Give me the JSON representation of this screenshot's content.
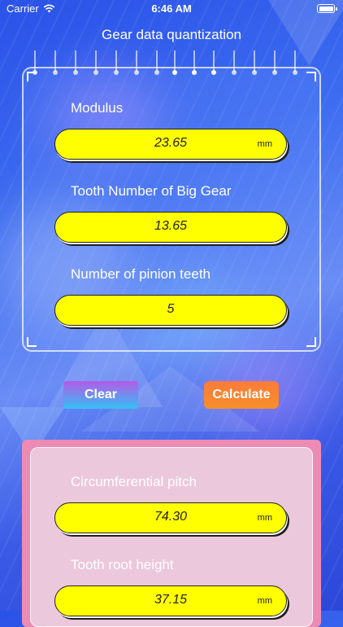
{
  "status": {
    "carrier": "Carrier",
    "time": "6:46 AM"
  },
  "title": "Gear data quantization",
  "inputs": [
    {
      "label": "Modulus",
      "value": "23.65",
      "unit": "mm"
    },
    {
      "label": "Tooth Number of Big Gear",
      "value": "13.65",
      "unit": ""
    },
    {
      "label": "Number of pinion teeth",
      "value": "5",
      "unit": ""
    }
  ],
  "buttons": {
    "clear": "Clear",
    "calculate": "Calculate"
  },
  "results": [
    {
      "label": "Circumferential pitch",
      "value": "74.30",
      "unit": "mm"
    },
    {
      "label": "Tooth root height",
      "value": "37.15",
      "unit": "mm"
    }
  ],
  "colors": {
    "field": "#ffff00",
    "result_panel": "#ec8bb4",
    "calculate": "#f58f2a"
  }
}
